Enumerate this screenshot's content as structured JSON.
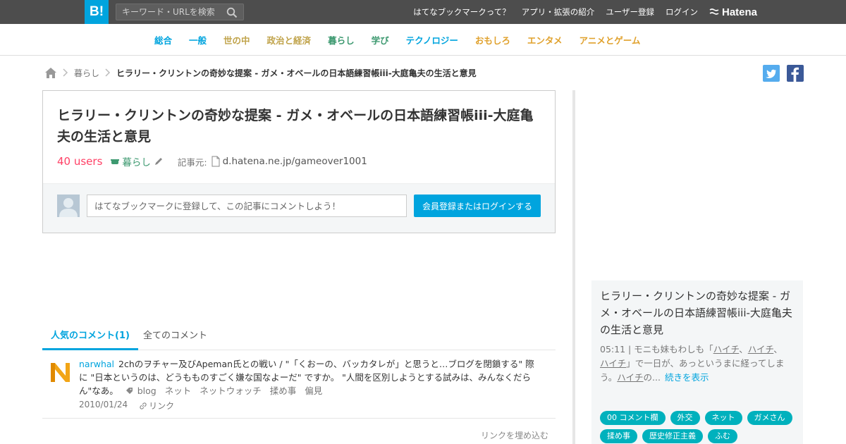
{
  "header": {
    "logo": "B!",
    "search_placeholder": "キーワード・URLを検索",
    "links": [
      "はてなブックマークって？",
      "アプリ・拡張の紹介",
      "ユーザー登録",
      "ログイン"
    ],
    "hatena_logo": "Hatena"
  },
  "categories": [
    {
      "label": "総合",
      "color": "#00a4de"
    },
    {
      "label": "一般",
      "color": "#00a4de"
    },
    {
      "label": "世の中",
      "color": "#c0a34a"
    },
    {
      "label": "政治と経済",
      "color": "#c0a34a"
    },
    {
      "label": "暮らし",
      "color": "#3d9970"
    },
    {
      "label": "学び",
      "color": "#3d9970"
    },
    {
      "label": "テクノロジー",
      "color": "#00a4de"
    },
    {
      "label": "おもしろ",
      "color": "#e0a12c"
    },
    {
      "label": "エンタメ",
      "color": "#e0a12c"
    },
    {
      "label": "アニメとゲーム",
      "color": "#e0a12c"
    }
  ],
  "breadcrumb": {
    "category": "暮らし",
    "current": "ヒラリー・クリントンの奇妙な提案 - ガメ・オベールの日本語練習帳iii-大庭亀夫の生活と意見"
  },
  "entry": {
    "title": "ヒラリー・クリントンの奇妙な提案 - ガメ・オベールの日本語練習帳iii-大庭亀夫の生活と意見",
    "users": "40 users",
    "category": "暮らし",
    "source_label": "記事元:",
    "source": "d.hatena.ne.jp/gameover1001"
  },
  "comment_box": {
    "placeholder": "はてなブックマークに登録して、この記事にコメントしよう！",
    "button": "会員登録またはログインする"
  },
  "tabs": {
    "popular": "人気のコメント(1)",
    "all": "全てのコメント"
  },
  "comment": {
    "user": "narwhal",
    "text": "2chのヲチャー及びApeman氏との戦い / \"「くおーの、バッカタレが」と思うと…ブログを閉鎖する\" 際に \"日本というのは、どうもものすごく嫌な国なよーだ\" ですか。 \"人間を区別しようとする試みは、みんなくだらん\"なあ。",
    "tags": [
      "blog",
      "ネット",
      "ネットウォッチ",
      "揉め事",
      "偏見"
    ],
    "date": "2010/01/24",
    "link": "リンク"
  },
  "embed_link": "リンクを埋め込む",
  "sidebar_card": {
    "title": "ヒラリー・クリントンの奇妙な提案 - ガメ・オベールの日本語練習帳iii-大庭亀夫の生活と意見",
    "excerpt_pre": "05:11 | モニも妹もわしも「",
    "excerpt_u1": "ハイチ",
    "excerpt_mid1": "、",
    "excerpt_u2": "ハイチ",
    "excerpt_mid2": "、",
    "excerpt_u3": "ハイチ",
    "excerpt_mid3": "」で一日が、あっというまに経ってしまう。",
    "excerpt_u4": "ハイチ",
    "excerpt_end": "の...",
    "more": "続きを表示",
    "tags": [
      "00 コメント欄",
      "外交",
      "ネット",
      "ガメさん",
      "揉め事",
      "歴史修正主義",
      "ふむ"
    ]
  }
}
